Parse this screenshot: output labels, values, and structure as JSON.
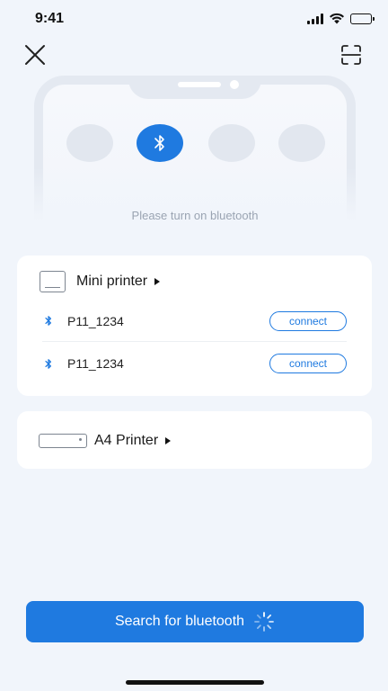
{
  "status_bar": {
    "time": "9:41"
  },
  "header": {
    "close_icon": "close-icon",
    "scan_icon": "scan-icon"
  },
  "illustration": {
    "hint": "Please turn on bluetooth",
    "active_icon": "bluetooth-icon"
  },
  "mini_printer": {
    "title": "Mini printer",
    "devices": [
      {
        "name": "P11_1234",
        "action": "connect"
      },
      {
        "name": "P11_1234",
        "action": "connect"
      }
    ]
  },
  "a4_printer": {
    "title": "A4 Printer"
  },
  "search": {
    "label": "Search for bluetooth",
    "icon": "loading-spinner-icon"
  },
  "colors": {
    "accent": "#1f7ae0",
    "background": "#f1f5fb",
    "card": "#ffffff",
    "hint_text": "#9aa4b2"
  }
}
